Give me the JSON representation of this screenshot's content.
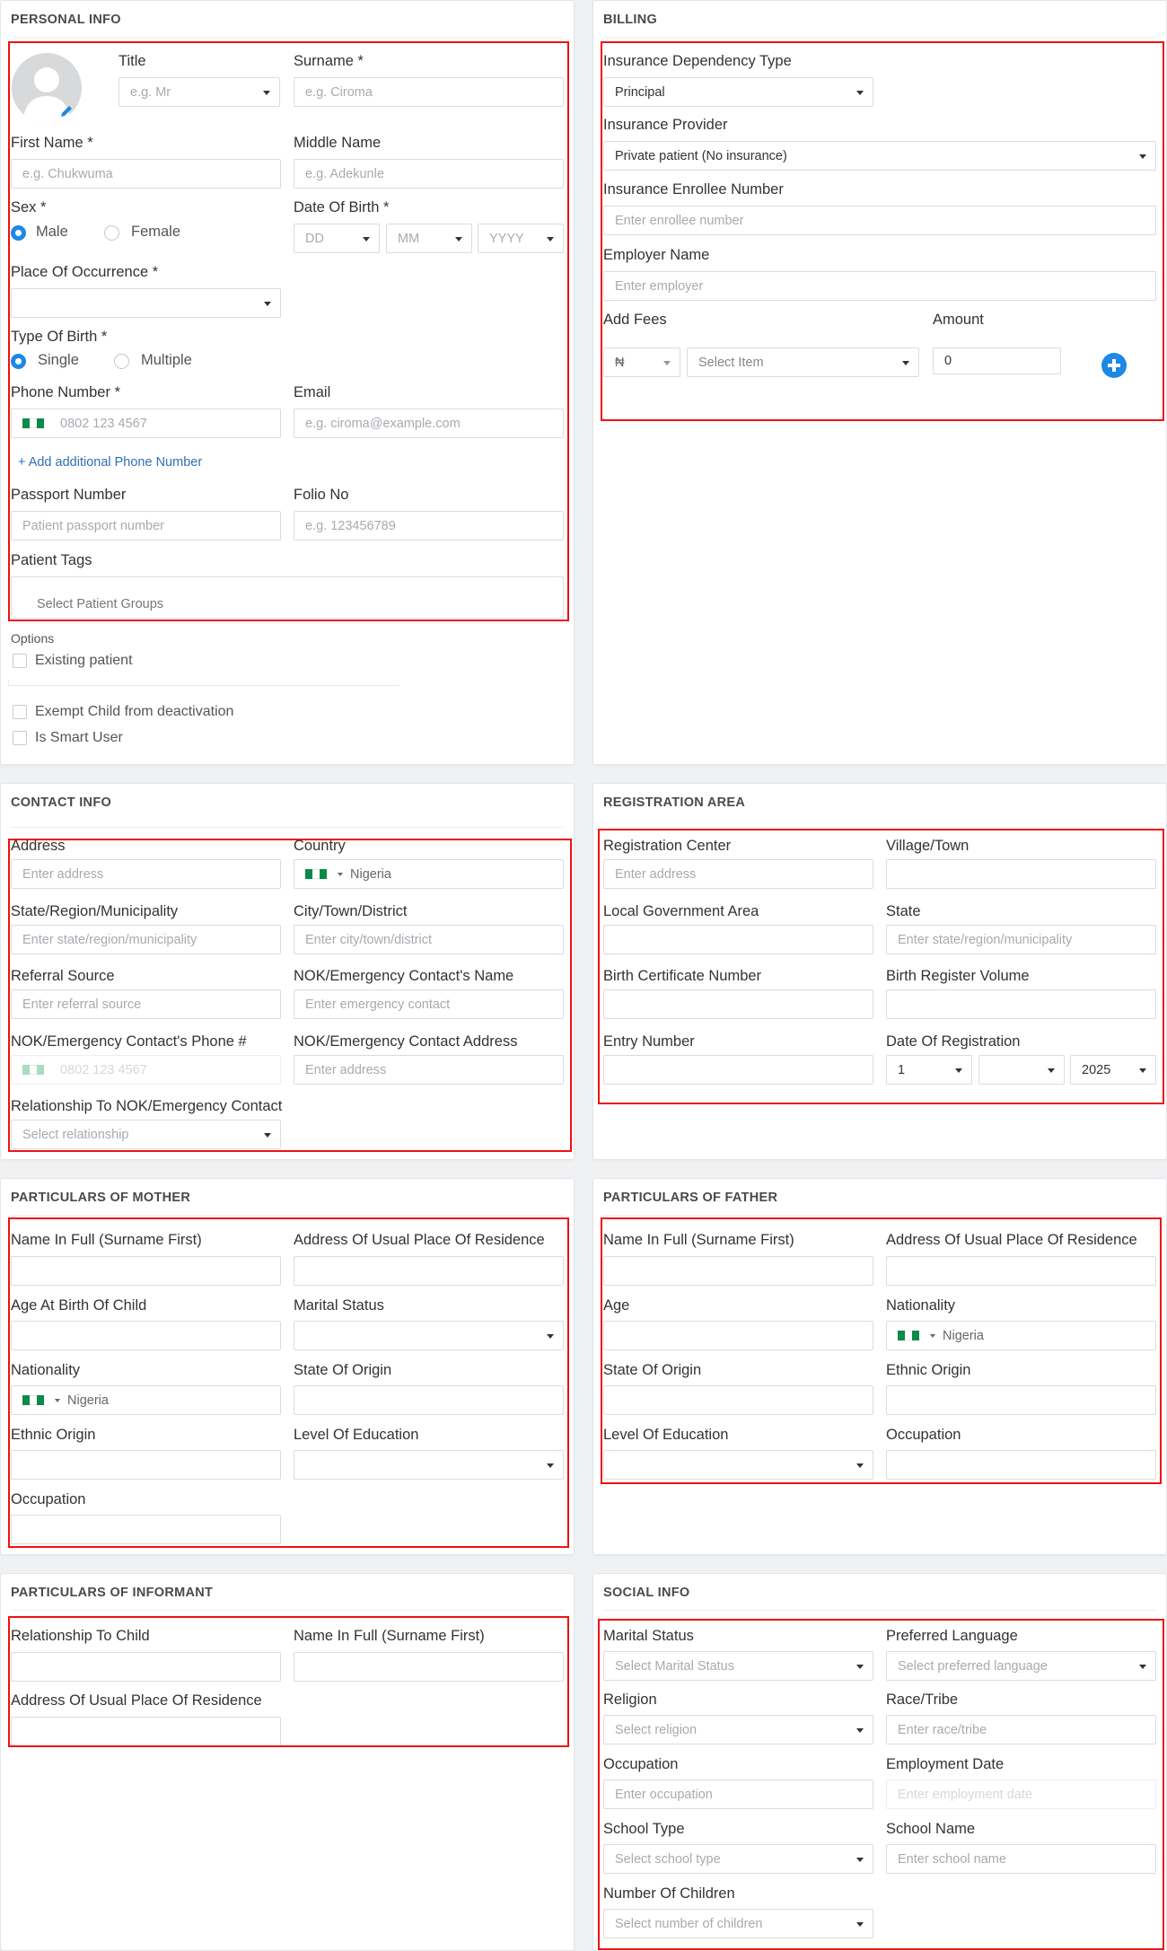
{
  "personal": {
    "title": "PERSONAL INFO",
    "title_label": "Title",
    "title_ph": "e.g. Mr",
    "surname_label": "Surname *",
    "surname_ph": "e.g. Ciroma",
    "firstname_label": "First Name *",
    "firstname_ph": "e.g. Chukwuma",
    "middlename_label": "Middle Name",
    "middlename_ph": "e.g. Adekunle",
    "sex_label": "Sex *",
    "sex_male": "Male",
    "sex_female": "Female",
    "dob_label": "Date Of Birth *",
    "dob_dd": "DD",
    "dob_mm": "MM",
    "dob_yyyy": "YYYY",
    "place_label": "Place Of Occurrence *",
    "birthtype_label": "Type Of Birth *",
    "birth_single": "Single",
    "birth_multiple": "Multiple",
    "phone_label": "Phone Number *",
    "phone_ph": "0802 123 4567",
    "email_label": "Email",
    "email_ph": "e.g. ciroma@example.com",
    "add_phone": "+ Add additional Phone Number",
    "passport_label": "Passport Number",
    "passport_ph": "Patient passport number",
    "folio_label": "Folio No",
    "folio_ph": "e.g. 123456789",
    "tags_label": "Patient Tags",
    "tags_ph": "Select Patient Groups",
    "options_label": "Options",
    "opt_existing": "Existing patient",
    "opt_exempt": "Exempt Child from deactivation",
    "opt_smart": "Is Smart User"
  },
  "billing": {
    "title": "BILLING",
    "dep_label": "Insurance Dependency Type",
    "dep_value": "Principal",
    "provider_label": "Insurance Provider",
    "provider_value": "Private patient (No insurance)",
    "enrollee_label": "Insurance Enrollee Number",
    "enrollee_ph": "Enter enrollee number",
    "employer_label": "Employer Name",
    "employer_ph": "Enter employer",
    "fees_label": "Add Fees",
    "amount_label": "Amount",
    "currency": "₦",
    "item_ph": "Select Item",
    "amount_value": "0"
  },
  "contact": {
    "title": "CONTACT INFO",
    "address_label": "Address",
    "address_ph": "Enter address",
    "country_label": "Country",
    "country_value": "Nigeria",
    "state_label": "State/Region/Municipality",
    "state_ph": "Enter state/region/municipality",
    "city_label": "City/Town/District",
    "city_ph": "Enter city/town/district",
    "referral_label": "Referral Source",
    "referral_ph": "Enter referral source",
    "nokname_label": "NOK/Emergency Contact's Name",
    "nokname_ph": "Enter emergency contact",
    "nokphone_label": "NOK/Emergency Contact's Phone #",
    "nokphone_ph": "0802 123 4567",
    "nokaddr_label": "NOK/Emergency Contact Address",
    "nokaddr_ph": "Enter address",
    "rel_label": "Relationship To NOK/Emergency Contact",
    "rel_ph": "Select relationship"
  },
  "registration": {
    "title": "REGISTRATION AREA",
    "center_label": "Registration Center",
    "center_ph": "Enter address",
    "village_label": "Village/Town",
    "lga_label": "Local Government Area",
    "state_label": "State",
    "state_ph": "Enter state/region/municipality",
    "birthcert_label": "Birth Certificate Number",
    "volume_label": "Birth Register Volume",
    "entry_label": "Entry Number",
    "regdate_label": "Date Of Registration",
    "regdate_day": "1",
    "regdate_year": "2025"
  },
  "mother": {
    "title": "PARTICULARS OF MOTHER",
    "name_label": "Name In Full (Surname First)",
    "address_label": "Address Of Usual Place Of Residence",
    "age_label": "Age At Birth Of Child",
    "marital_label": "Marital Status",
    "nationality_label": "Nationality",
    "nationality_value": "Nigeria",
    "origin_label": "State Of Origin",
    "ethnic_label": "Ethnic Origin",
    "education_label": "Level Of Education",
    "occupation_label": "Occupation"
  },
  "father": {
    "title": "PARTICULARS OF FATHER",
    "name_label": "Name In Full (Surname First)",
    "address_label": "Address Of Usual Place Of Residence",
    "age_label": "Age",
    "nationality_label": "Nationality",
    "nationality_value": "Nigeria",
    "origin_label": "State Of Origin",
    "ethnic_label": "Ethnic Origin",
    "education_label": "Level Of Education",
    "occupation_label": "Occupation"
  },
  "informant": {
    "title": "PARTICULARS OF INFORMANT",
    "rel_label": "Relationship To Child",
    "name_label": "Name In Full (Surname First)",
    "address_label": "Address Of Usual Place Of Residence"
  },
  "social": {
    "title": "SOCIAL INFO",
    "marital_label": "Marital Status",
    "marital_ph": "Select Marital Status",
    "lang_label": "Preferred Language",
    "lang_ph": "Select preferred language",
    "religion_label": "Religion",
    "religion_ph": "Select religion",
    "race_label": "Race/Tribe",
    "race_ph": "Enter race/tribe",
    "occupation_label": "Occupation",
    "occupation_ph": "Enter occupation",
    "empdate_label": "Employment Date",
    "empdate_ph": "Enter employment date",
    "schooltype_label": "School Type",
    "schooltype_ph": "Select school type",
    "schoolname_label": "School Name",
    "schoolname_ph": "Enter school name",
    "children_label": "Number Of Children",
    "children_ph": "Select number of children"
  },
  "colors": {
    "accent": "#1e88e5",
    "highlight": "#ee1111",
    "link": "#2f6fb5"
  }
}
